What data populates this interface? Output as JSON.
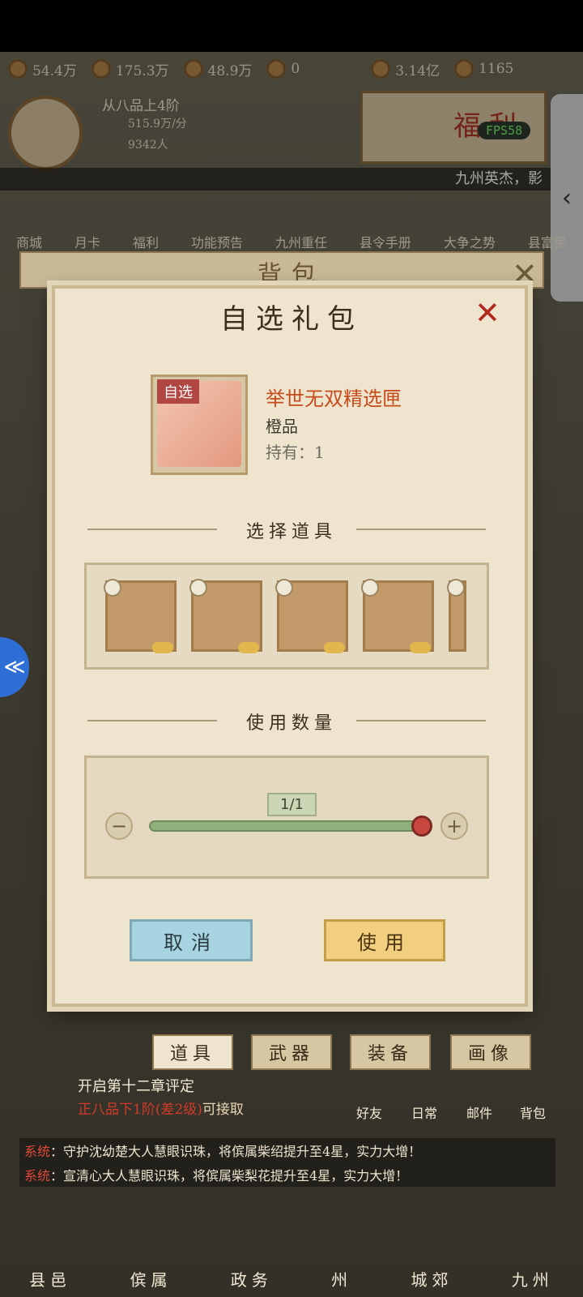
{
  "resources": [
    "54.4万",
    "175.3万",
    "48.9万",
    "0",
    "3.14亿",
    "1165"
  ],
  "player": {
    "rank": "从八品上4阶",
    "rate": "515.9万/分",
    "people": "9342人"
  },
  "welfare_banner": "福利",
  "fps": "FPS58",
  "marquee": "九州英杰，影",
  "nav": [
    "商城",
    "月卡",
    "福利",
    "功能预告",
    "九州重任",
    "县令手册",
    "大争之势",
    "县富民"
  ],
  "bag": {
    "title": "背包",
    "close_icon": "✕"
  },
  "dialog": {
    "title": "自选礼包",
    "close_icon": "✕",
    "item": {
      "badge": "自选",
      "name": "举世无双精选匣",
      "grade": "橙品",
      "owned": "持有：1"
    },
    "section_select": "选择道具",
    "section_quantity": "使用数量",
    "quantity_value": "1/1",
    "quantity_fraction": 1.0,
    "minus": "−",
    "plus": "+",
    "cancel_label": "取消",
    "use_label": "使用"
  },
  "tabs": [
    "道具",
    "武器",
    "装备",
    "画像"
  ],
  "chapter": {
    "title": "开启第十二章评定",
    "requirement_red": "正八品下1阶(差2级)",
    "requirement_tail": "可接取"
  },
  "quick_links": [
    "好友",
    "日常",
    "邮件",
    "背包"
  ],
  "system_messages": [
    {
      "tag": "系统",
      "text": "：守护沈幼楚大人慧眼识珠，将傧属柴绍提升至4星，实力大增！"
    },
    {
      "tag": "系统",
      "text": "：宣清心大人慧眼识珠，将傧属柴梨花提升至4星，实力大增！"
    }
  ],
  "bottom_nav": [
    "县邑",
    "傧属",
    "政务",
    "州",
    "城郊",
    "九州"
  ],
  "colors": {
    "accent_red": "#b12a1d",
    "item_orange": "#c64a1a",
    "slider_green": "#8fb07a"
  }
}
